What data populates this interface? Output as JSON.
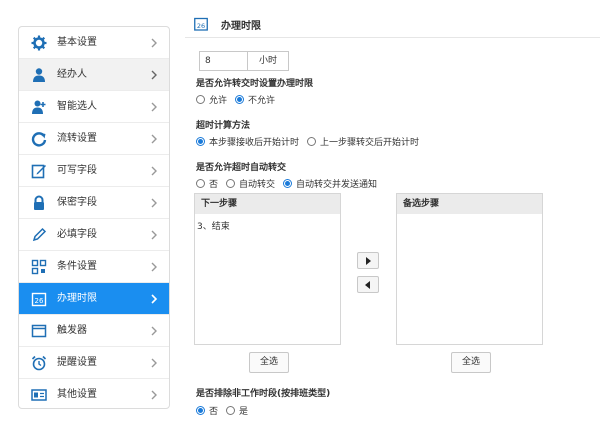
{
  "sidebar": {
    "items": [
      {
        "label": "基本设置"
      },
      {
        "label": "经办人"
      },
      {
        "label": "智能选人"
      },
      {
        "label": "流转设置"
      },
      {
        "label": "可写字段"
      },
      {
        "label": "保密字段"
      },
      {
        "label": "必填字段"
      },
      {
        "label": "条件设置"
      },
      {
        "label": "办理时限"
      },
      {
        "label": "触发器"
      },
      {
        "label": "提醒设置"
      },
      {
        "label": "其他设置"
      }
    ]
  },
  "header": {
    "icon_text": "26",
    "title": "办理时限"
  },
  "time_limit": {
    "value": "8",
    "unit": "小时"
  },
  "allow_turn": {
    "label": "是否允许转交时设置办理时限",
    "options": [
      "允许",
      "不允许"
    ],
    "selected": "不允许"
  },
  "timeout_method": {
    "label": "超时计算方法",
    "options": [
      "本步骤接收后开始计时",
      "上一步骤转交后开始计时"
    ],
    "selected": "本步骤接收后开始计时"
  },
  "auto_turn": {
    "label": "是否允许超时自动转交",
    "options": [
      "否",
      "自动转交",
      "自动转交并发送通知"
    ],
    "selected": "自动转交并发送通知"
  },
  "next_steps": {
    "header": "下一步骤",
    "items": [
      "3、结束"
    ],
    "select_all": "全选"
  },
  "candidate_steps": {
    "header": "备选步骤",
    "items": [],
    "select_all": "全选"
  },
  "exclude_nonwork": {
    "label": "是否排除非工作时段(按排班类型)",
    "options": [
      "否",
      "是"
    ],
    "selected": "否"
  },
  "colors": {
    "accent": "#1a8ef0",
    "icon": "#1f6fb5"
  }
}
